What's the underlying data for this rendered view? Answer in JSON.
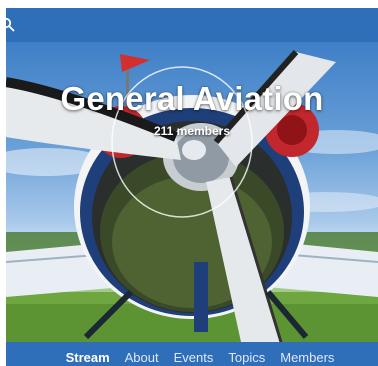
{
  "topbar": {
    "search_icon": "search-icon",
    "color": "#2f6fba"
  },
  "group": {
    "title": "General Aviation",
    "members": "211 members"
  },
  "tabs": [
    {
      "label": "Stream",
      "active": true
    },
    {
      "label": "About",
      "active": false
    },
    {
      "label": "Events",
      "active": false
    },
    {
      "label": "Topics",
      "active": false
    },
    {
      "label": "Members",
      "active": false
    }
  ],
  "colors": {
    "brand_blue": "#2f6fba",
    "text_white": "#ffffff"
  }
}
